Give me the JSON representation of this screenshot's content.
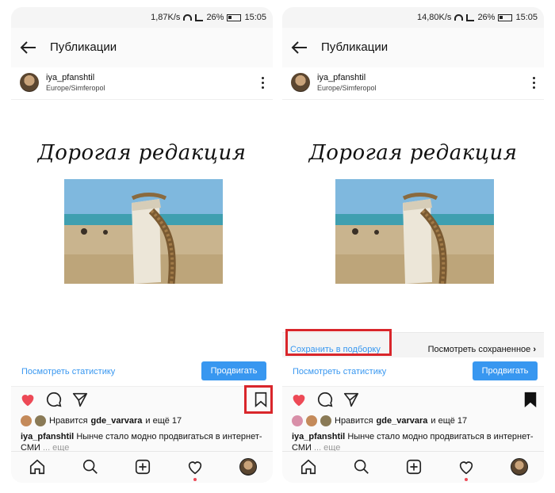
{
  "left": {
    "status": {
      "speed": "1,87K/s",
      "battery": "26%",
      "time": "15:05"
    },
    "appbar": {
      "title": "Публикации"
    },
    "post": {
      "username": "iya_pfanshtil",
      "location": "Europe/Simferopol",
      "image_title": "Дорогая редакция"
    },
    "stats": {
      "link": "Посмотреть статистику",
      "promote": "Продвигать"
    },
    "likes": {
      "prefix": "Нравится",
      "user": "gde_varvara",
      "suffix": "и ещё 17"
    },
    "caption": {
      "user": "iya_pfanshtil",
      "text": "Нынче стало модно продвигаться в интернет-СМИ",
      "more": "... еще"
    }
  },
  "right": {
    "status": {
      "speed": "14,80K/s",
      "battery": "26%",
      "time": "15:05"
    },
    "appbar": {
      "title": "Публикации"
    },
    "post": {
      "username": "iya_pfanshtil",
      "location": "Europe/Simferopol",
      "image_title": "Дорогая редакция"
    },
    "save": {
      "link": "Сохранить в подборку",
      "view_saved": "Посмотреть сохраненное",
      "chevron": "›"
    },
    "stats": {
      "link": "Посмотреть статистику",
      "promote": "Продвигать"
    },
    "likes": {
      "prefix": "Нравится",
      "user": "gde_varvara",
      "suffix": "и ещё 17"
    },
    "caption": {
      "user": "iya_pfanshtil",
      "text": "Нынче стало модно продвигаться в интернет-СМИ",
      "more": "... еще"
    }
  },
  "colors": {
    "accent": "#3897f0",
    "like": "#ed4956",
    "highlight": "#d9262b"
  },
  "icons": [
    "back-arrow-icon",
    "more-icon",
    "heart-icon",
    "comment-icon",
    "share-icon",
    "bookmark-icon",
    "home-icon",
    "search-icon",
    "add-icon",
    "activity-icon"
  ]
}
